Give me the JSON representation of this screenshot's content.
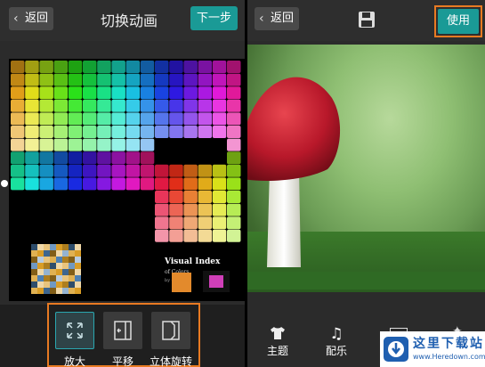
{
  "left": {
    "back_label": "返回",
    "title": "切换动画",
    "next_label": "下一步",
    "options": [
      {
        "label": "放大",
        "icon": "expand-icon",
        "selected": true
      },
      {
        "label": "平移",
        "icon": "slide-icon",
        "selected": false
      },
      {
        "label": "立体旋转",
        "icon": "rotate-3d-icon",
        "selected": false
      }
    ],
    "chart": {
      "title": "Visual Index",
      "subtitle": "of Colors",
      "caption": "by color"
    }
  },
  "right": {
    "back_label": "返回",
    "use_label": "使用",
    "tools": [
      {
        "label": "主题",
        "icon": "shirt-icon"
      },
      {
        "label": "配乐",
        "icon": "music-note-icon"
      }
    ]
  },
  "watermark": {
    "name": "这里下载站",
    "url": "www.Heredown.com"
  },
  "colors": {
    "accent": "#1a9a96",
    "highlight": "#e87a22"
  }
}
